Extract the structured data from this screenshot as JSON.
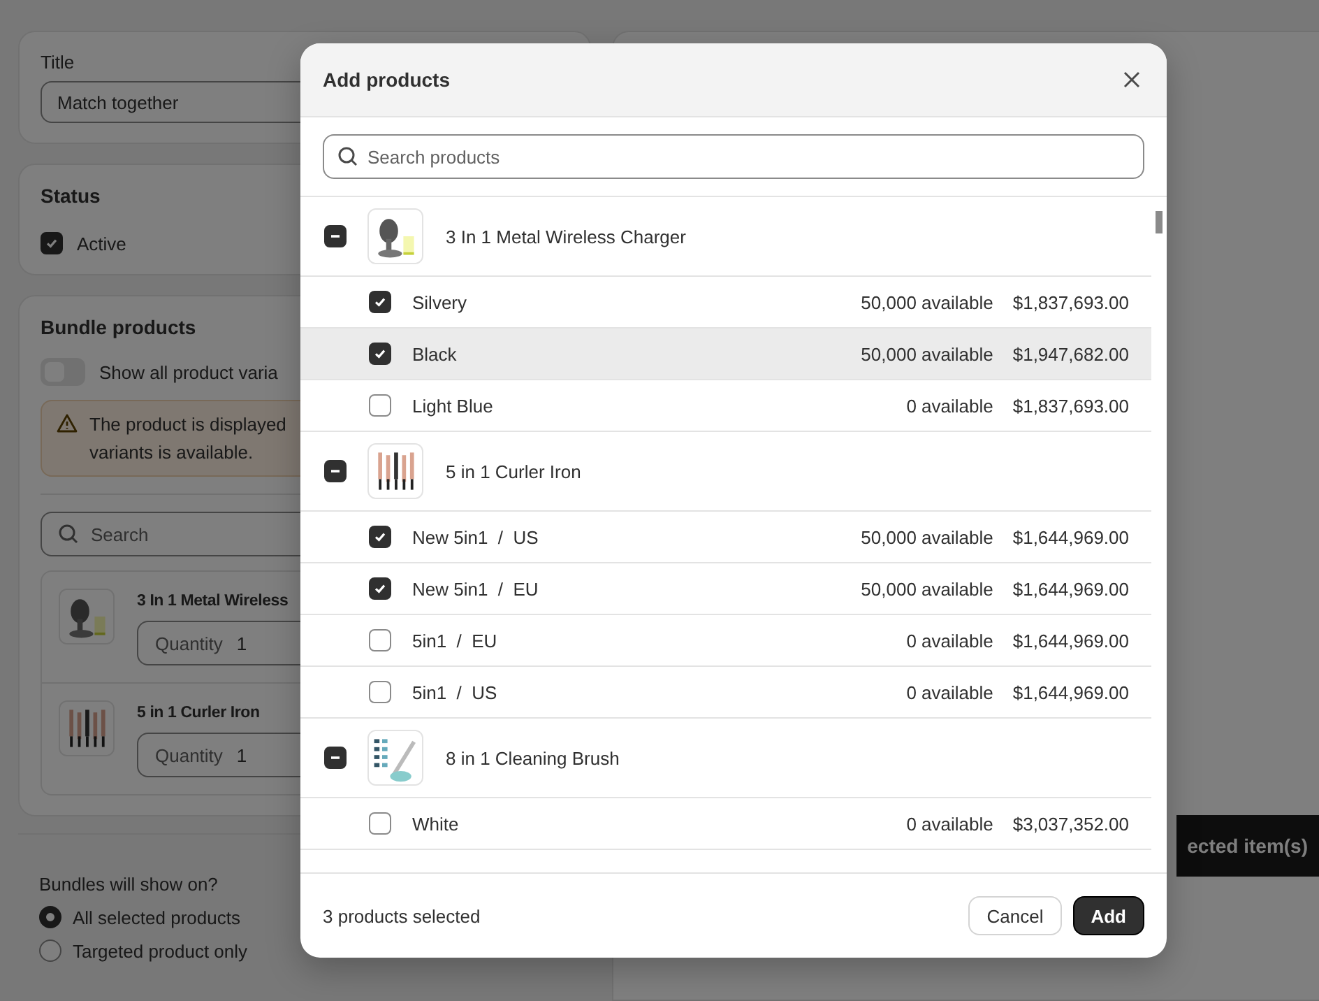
{
  "background": {
    "title_card": {
      "label": "Title",
      "value": "Match together"
    },
    "status_card": {
      "heading": "Status",
      "checkbox": {
        "label": "Active",
        "checked": true
      }
    },
    "bundle_card": {
      "heading": "Bundle products",
      "toggle": {
        "label": "Show all product varia",
        "on": false
      },
      "warning": [
        "The product is displayed",
        "variants is available."
      ],
      "search": {
        "placeholder": "Search"
      },
      "items": [
        {
          "name": "3 In 1 Metal Wireless",
          "quantity_label": "Quantity",
          "quantity": "1"
        },
        {
          "name": "5 in 1 Curler Iron",
          "quantity_label": "Quantity",
          "quantity": "1"
        }
      ]
    },
    "show_on": {
      "heading": "Bundles will show on?",
      "options": [
        {
          "label": "All selected products",
          "selected": true
        },
        {
          "label": "Targeted product only",
          "selected": false
        }
      ]
    },
    "right_button": "ected item(s)"
  },
  "modal": {
    "title": "Add products",
    "search": {
      "placeholder": "Search products"
    },
    "products": [
      {
        "name": "3 In 1 Metal Wireless Charger",
        "indeterminate": true,
        "variants": [
          {
            "name": "Silvery",
            "available": "50,000 available",
            "price": "$1,837,693.00",
            "checked": true,
            "hovered": false
          },
          {
            "name": "Black",
            "available": "50,000 available",
            "price": "$1,947,682.00",
            "checked": true,
            "hovered": true
          },
          {
            "name": "Light Blue",
            "available": "0 available",
            "price": "$1,837,693.00",
            "checked": false,
            "hovered": false
          }
        ]
      },
      {
        "name": "5 in 1 Curler Iron",
        "indeterminate": true,
        "variants": [
          {
            "name": "New 5in1  /  US",
            "available": "50,000 available",
            "price": "$1,644,969.00",
            "checked": true,
            "hovered": false
          },
          {
            "name": "New 5in1  /  EU",
            "available": "50,000 available",
            "price": "$1,644,969.00",
            "checked": true,
            "hovered": false
          },
          {
            "name": "5in1  /  EU",
            "available": "0 available",
            "price": "$1,644,969.00",
            "checked": false,
            "hovered": false
          },
          {
            "name": "5in1  /  US",
            "available": "0 available",
            "price": "$1,644,969.00",
            "checked": false,
            "hovered": false
          }
        ]
      },
      {
        "name": "8 in 1 Cleaning Brush",
        "indeterminate": true,
        "variants": [
          {
            "name": "White",
            "available": "0 available",
            "price": "$3,037,352.00",
            "checked": false,
            "hovered": false
          }
        ]
      }
    ],
    "footer_text": "3 products selected",
    "buttons": [
      {
        "label": "Cancel",
        "kind": "secondary"
      },
      {
        "label": "Add",
        "kind": "primary"
      }
    ]
  }
}
